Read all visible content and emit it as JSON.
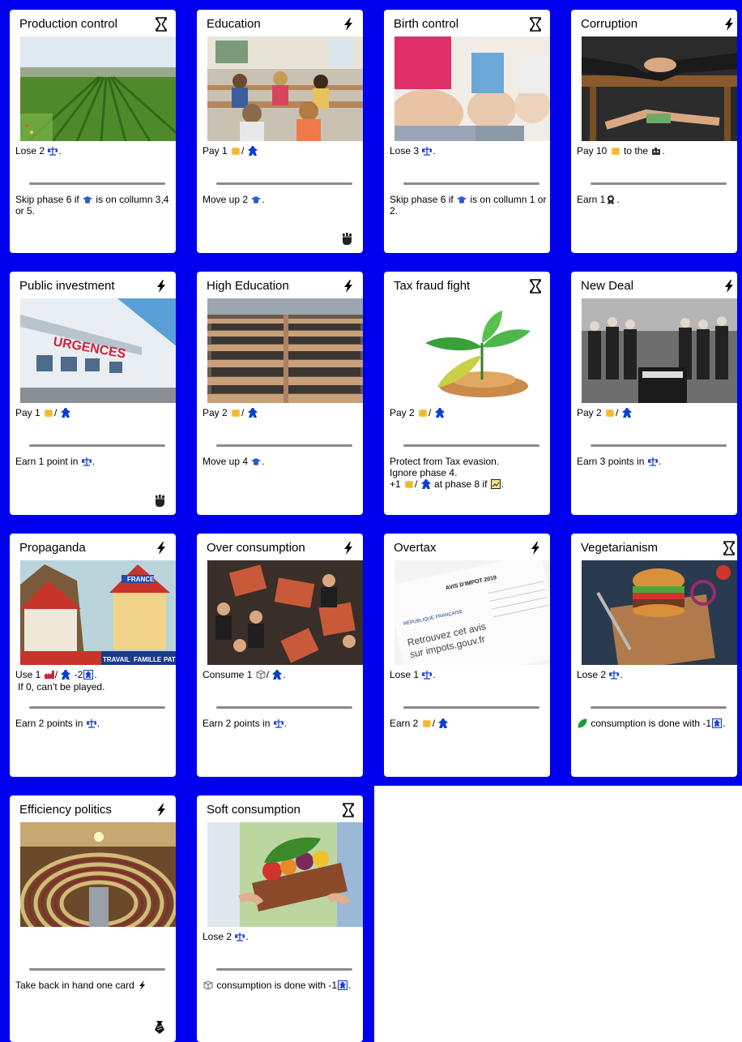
{
  "cards": [
    {
      "title": "Production control",
      "type_icon": "hourglass-icon",
      "cost": {
        "pre": "Lose 2",
        "post": "."
      },
      "effect": "Skip phase 6 if [academic] is on collumn 3,4 or 5.",
      "effect_text": "Skip phase 6 if",
      "effect_text2": "is on collumn 3,4 or 5."
    },
    {
      "title": "Education",
      "type_icon": "lightning-icon",
      "cost": {
        "pre": "Pay 1",
        "post": ""
      },
      "effect_text": "Move up 2",
      "effect_text2": ".",
      "corner_icon": "fist-icon"
    },
    {
      "title": "Birth control",
      "type_icon": "hourglass-icon",
      "cost": {
        "pre": "Lose 3",
        "post": "."
      },
      "effect_text": "Skip phase 6 if",
      "effect_text2": "is on collumn 1 or 2."
    },
    {
      "title": "Corruption",
      "type_icon": "lightning-icon",
      "cost": {
        "pre": "Pay 10",
        "mid": "to the",
        "post": "."
      },
      "effect_text": "Earn 1",
      "effect_text2": "."
    },
    {
      "title": "Public investment",
      "type_icon": "lightning-icon",
      "cost": {
        "pre": "Pay 1",
        "post": ""
      },
      "effect_text": "Earn 1 point in",
      "effect_text2": ".",
      "corner_icon": "fist-icon"
    },
    {
      "title": "High Education",
      "type_icon": "lightning-icon",
      "cost": {
        "pre": "Pay 2",
        "post": ""
      },
      "effect_text": "Move up 4",
      "effect_text2": "."
    },
    {
      "title": "Tax fraud fight",
      "type_icon": "hourglass-icon",
      "cost": {
        "pre": "Pay 2",
        "post": ""
      },
      "effect_line1": "Protect from Tax evasion.",
      "effect_line2": "Ignore phase 4.",
      "effect_line3_pre": "+1",
      "effect_line3_mid": "at phase 8 if",
      "effect_line3_post": "."
    },
    {
      "title": "New Deal",
      "type_icon": "lightning-icon",
      "cost": {
        "pre": "Pay 2",
        "post": ""
      },
      "effect_text": "Earn 3 points in",
      "effect_text2": "."
    },
    {
      "title": "Propaganda",
      "type_icon": "lightning-icon",
      "cost": {
        "pre": "Use 1",
        "mid": "-2",
        "post": "."
      },
      "cost_line2": "If 0, can’t be played.",
      "effect_text": "Earn 2 points in",
      "effect_text2": "."
    },
    {
      "title": "Over consumption",
      "type_icon": "lightning-icon",
      "cost": {
        "pre": "Consume 1",
        "post": "."
      },
      "effect_text": "Earn 2 points in",
      "effect_text2": "."
    },
    {
      "title": "Overtax",
      "type_icon": "lightning-icon",
      "cost": {
        "pre": "Lose 1",
        "post": "."
      },
      "effect_text": "Earn 2",
      "effect_text2": ""
    },
    {
      "title": "Vegetarianism",
      "type_icon": "hourglass-icon",
      "cost": {
        "pre": "Lose 2",
        "post": "."
      },
      "effect_text": "consumption is done with -1",
      "effect_text2": "."
    },
    {
      "title": "Efficiency politics",
      "type_icon": "lightning-icon",
      "cost": {
        "pre": "",
        "post": ""
      },
      "effect_text": "Take back in hand one card",
      "effect_text2": "",
      "corner_icon": "tie-icon"
    },
    {
      "title": "Soft consumption",
      "type_icon": "hourglass-icon",
      "cost": {
        "pre": "Lose 2",
        "post": "."
      },
      "effect_text": "consumption is done with -1",
      "effect_text2": "."
    }
  ],
  "art_labels": {
    "urgences": "URGENCES",
    "france": "FRANCE",
    "travail": "TRAVAIL",
    "famille": "FAMILLE",
    "patrie": "PATRIE",
    "avis": "AVIS D'IMPOT 2019",
    "retrouvez": "Retrouvez cet avis",
    "impots": "sur impots.gouv.fr",
    "republique": "RÉPUBLIQUE FRANÇAISE"
  },
  "icon_colors": {
    "coin": "#f5c542",
    "meeple": "#0a3fd1",
    "scale": "#1d3fd4",
    "academic": "#2a5bd6",
    "leaf": "#1f9a3a"
  }
}
